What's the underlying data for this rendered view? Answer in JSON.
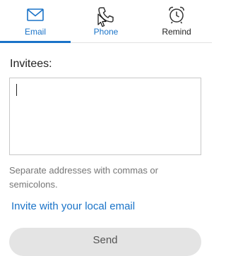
{
  "tabs": [
    {
      "label": "Email",
      "icon": "envelope-icon",
      "active": true
    },
    {
      "label": "Phone",
      "icon": "phone-icon",
      "active": false
    },
    {
      "label": "Remind",
      "icon": "alarm-clock-icon",
      "active": false
    }
  ],
  "form": {
    "invitees_label": "Invitees:",
    "invitees_value": "",
    "hint": "Separate addresses with commas or semicolons.",
    "local_email_link": "Invite with your local email",
    "send_label": "Send"
  },
  "colors": {
    "accent": "#1a73c8",
    "button_bg": "#e4e4e4",
    "hint_text": "#767676"
  }
}
